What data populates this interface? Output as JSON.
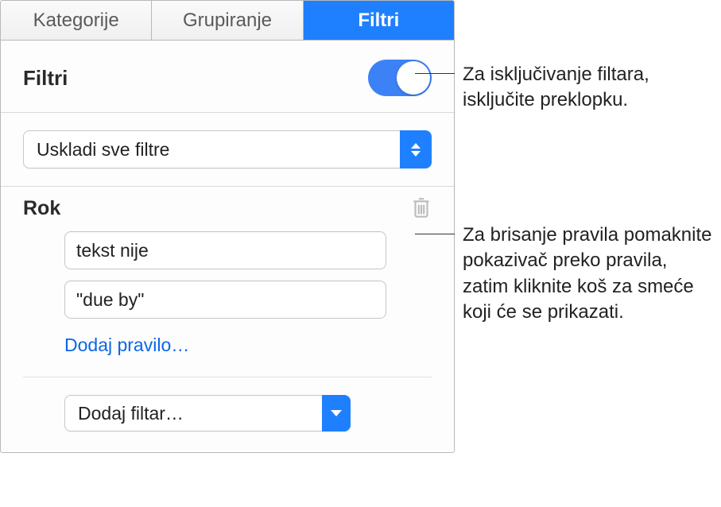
{
  "tabs": [
    {
      "label": "Kategorije",
      "active": false
    },
    {
      "label": "Grupiranje",
      "active": false
    },
    {
      "label": "Filtri",
      "active": true
    }
  ],
  "section": {
    "title": "Filtri",
    "toggle_on": true
  },
  "match_filter": {
    "selected": "Uskladi sve filtre"
  },
  "rule": {
    "title": "Rok",
    "condition": "tekst nije",
    "value": "\"due by\"",
    "add_rule_link": "Dodaj pravilo…"
  },
  "add_filter": {
    "selected": "Dodaj filtar…"
  },
  "callouts": {
    "toggle": "Za isključivanje filtara, isključite preklopku.",
    "trash": "Za brisanje pravila pomaknite pokazivač preko pravila, zatim kliknite koš za smeće koji će se prikazati."
  }
}
